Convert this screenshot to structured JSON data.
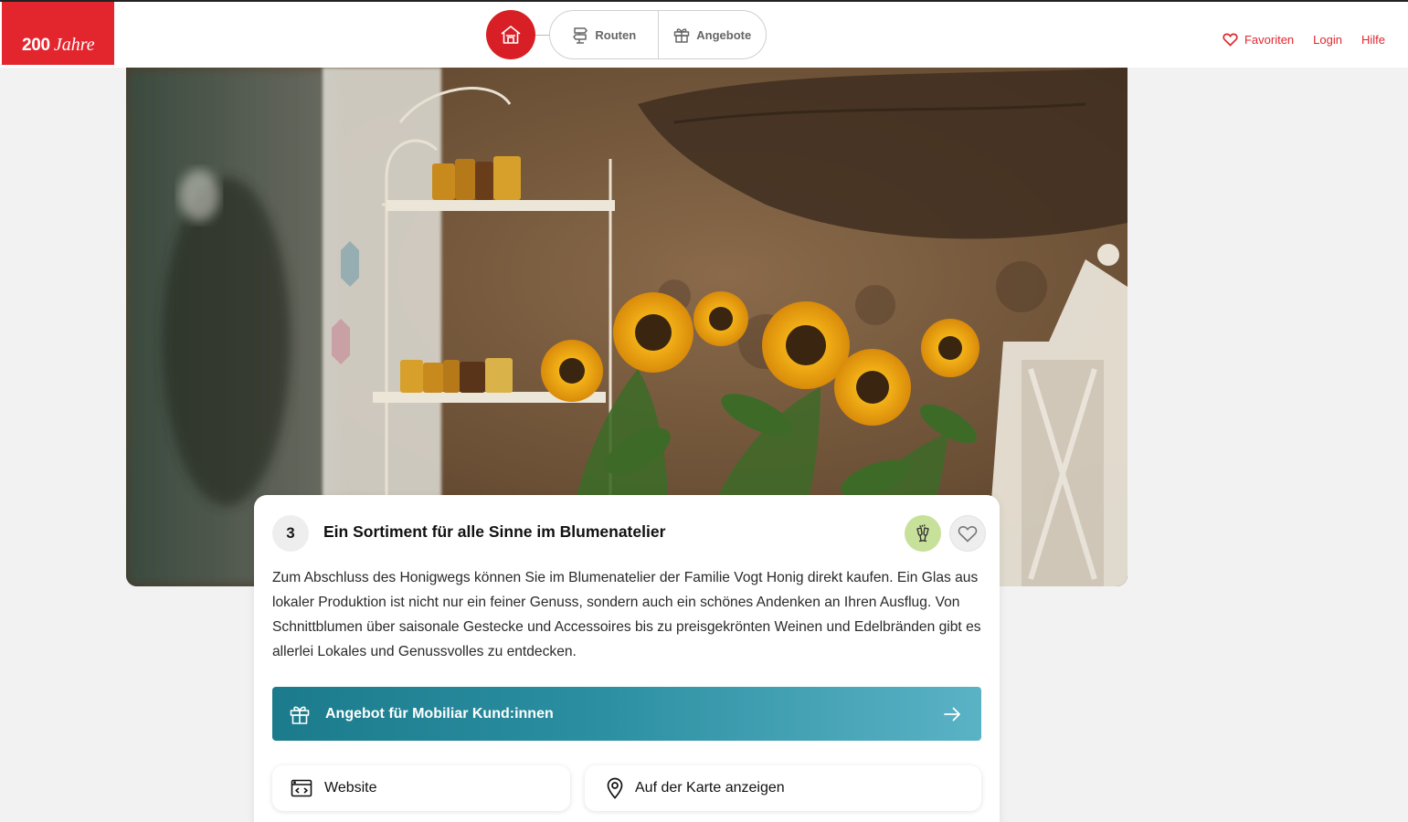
{
  "header": {
    "logo_number": "200",
    "logo_word": "Jahre",
    "nav_tabs": [
      {
        "label": "Routen",
        "icon": "signpost-icon"
      },
      {
        "label": "Angebote",
        "icon": "gift-icon"
      }
    ],
    "right_links": {
      "favorites": "Favoriten",
      "login": "Login",
      "help": "Hilfe"
    },
    "accent_color": "#e3262e"
  },
  "card": {
    "number": "3",
    "title": "Ein Sortiment für alle Sinne im Blumenatelier",
    "description": "Zum Abschluss des Honigwegs können Sie im Blumenatelier der Familie Vogt Honig direkt kaufen. Ein Glas aus lokaler Produktion ist nicht nur ein feiner Genuss, sondern auch ein schönes Andenken an Ihren Ausflug. Von Schnittblumen über saisonale Gestecke und Accessoires bis zu preisgekrönten Weinen und Edelbränden gibt es allerlei Lokales und Genussvolles zu entdecken.",
    "offer_label": "Angebot für Mobiliar Kund:innen",
    "website_label": "Website",
    "map_label": "Auf der Karte anzeigen",
    "tag_icon": "cheers-glasses-icon",
    "tag_color": "#c7e19a",
    "offer_gradient": [
      "#1b7b8c",
      "#5ab2c5"
    ]
  }
}
